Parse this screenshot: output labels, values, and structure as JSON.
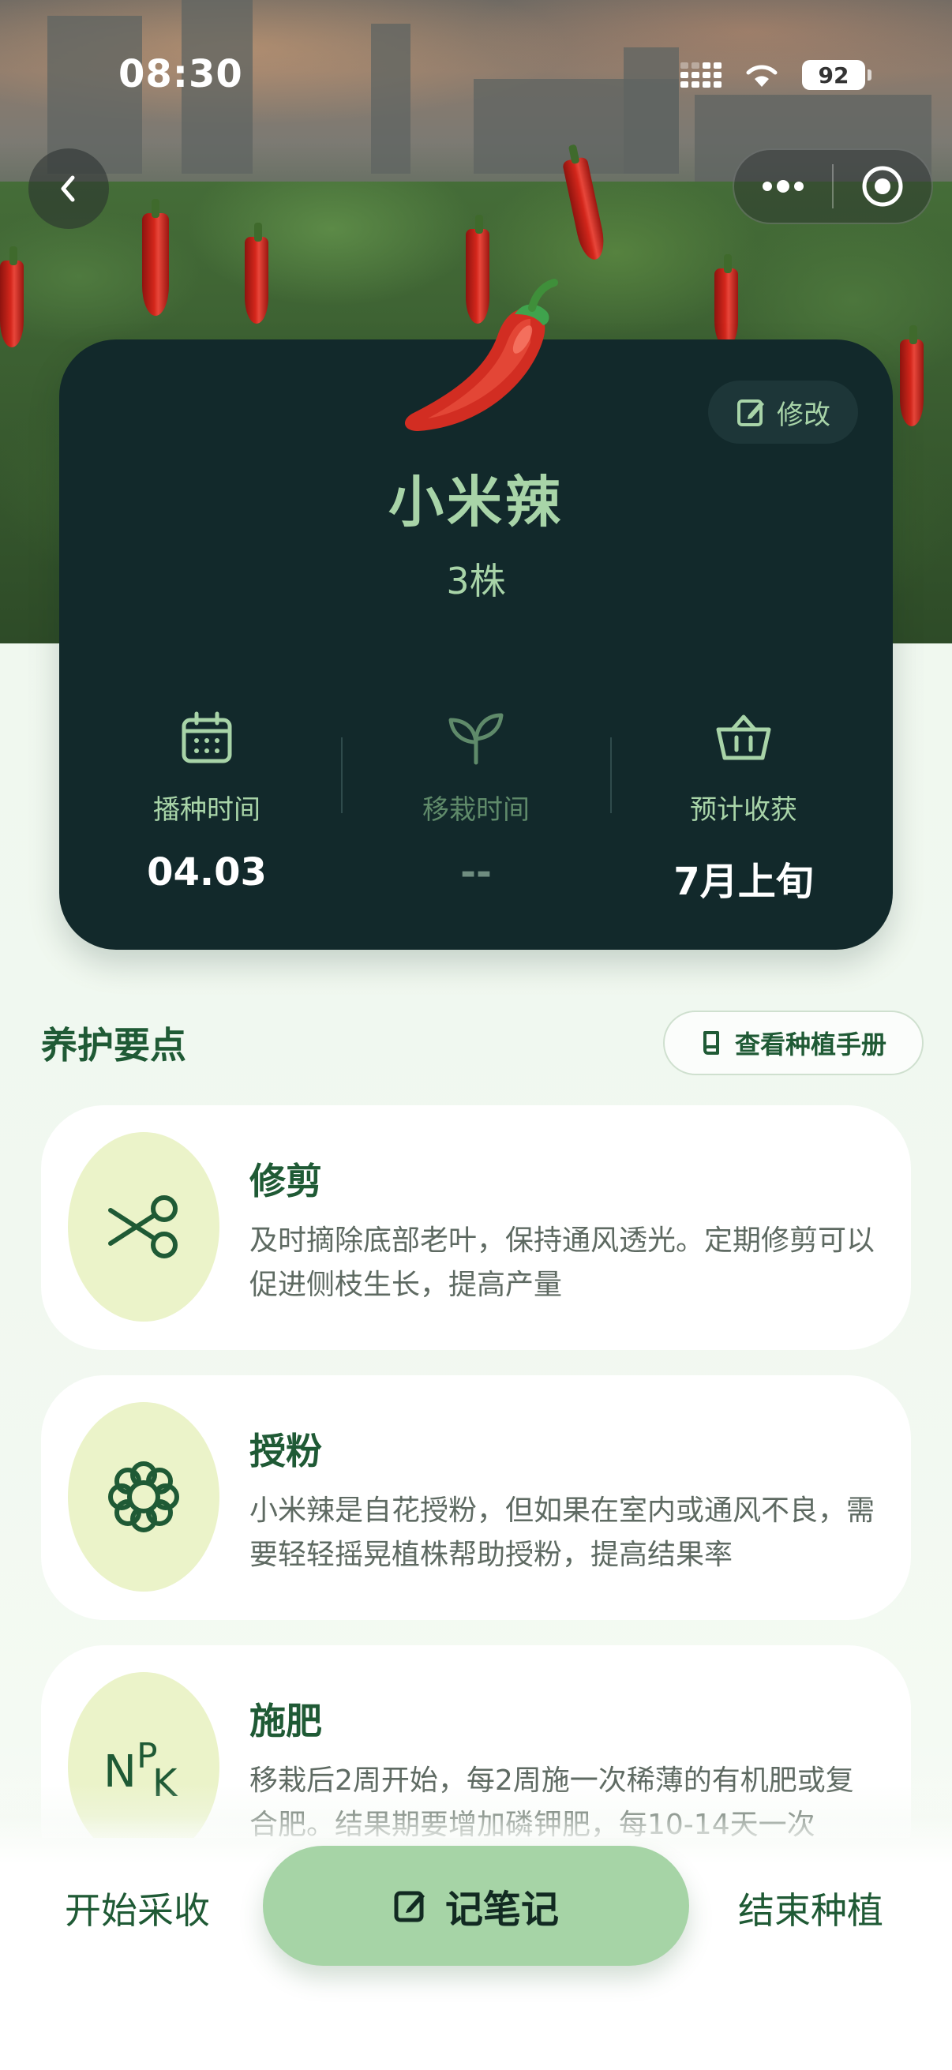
{
  "status_bar": {
    "time": "08:30",
    "battery": "92"
  },
  "nav": {
    "back_icon": "chevron-left-icon",
    "more_icon": "more-dots-icon",
    "close_icon": "target-circle-icon"
  },
  "plant": {
    "emoji": "🌶️",
    "name": "小米辣",
    "count": "3株",
    "edit_label": "修改",
    "stats": [
      {
        "icon": "calendar-icon",
        "label": "播种时间",
        "value": "04.03"
      },
      {
        "icon": "sprout-icon",
        "label": "移栽时间",
        "value": "--"
      },
      {
        "icon": "basket-icon",
        "label": "预计收获",
        "value": "7月上旬"
      }
    ]
  },
  "care": {
    "title": "养护要点",
    "manual_button": "查看种植手册",
    "items": [
      {
        "icon": "scissors-icon",
        "title": "修剪",
        "desc": "及时摘除底部老叶，保持通风透光。定期修剪可以促进侧枝生长，提高产量"
      },
      {
        "icon": "flower-icon",
        "title": "授粉",
        "desc": "小米辣是自花授粉，但如果在室内或通风不良，需要轻轻摇晃植株帮助授粉，提高结果率"
      },
      {
        "icon": "npk-icon",
        "title": "施肥",
        "desc": "移栽后2周开始，每2周施一次稀薄的有机肥或复合肥。结果期要增加磷钾肥，每10-14天一次"
      }
    ]
  },
  "bottom": {
    "left": "开始采收",
    "center": "记笔记",
    "right": "结束种植"
  },
  "colors": {
    "card_bg": "#12292b",
    "accent_green": "#a8d4a8",
    "title_green": "#1f5a35",
    "icon_blob": "#ebf3c9",
    "button_green": "#a6d4a6"
  }
}
